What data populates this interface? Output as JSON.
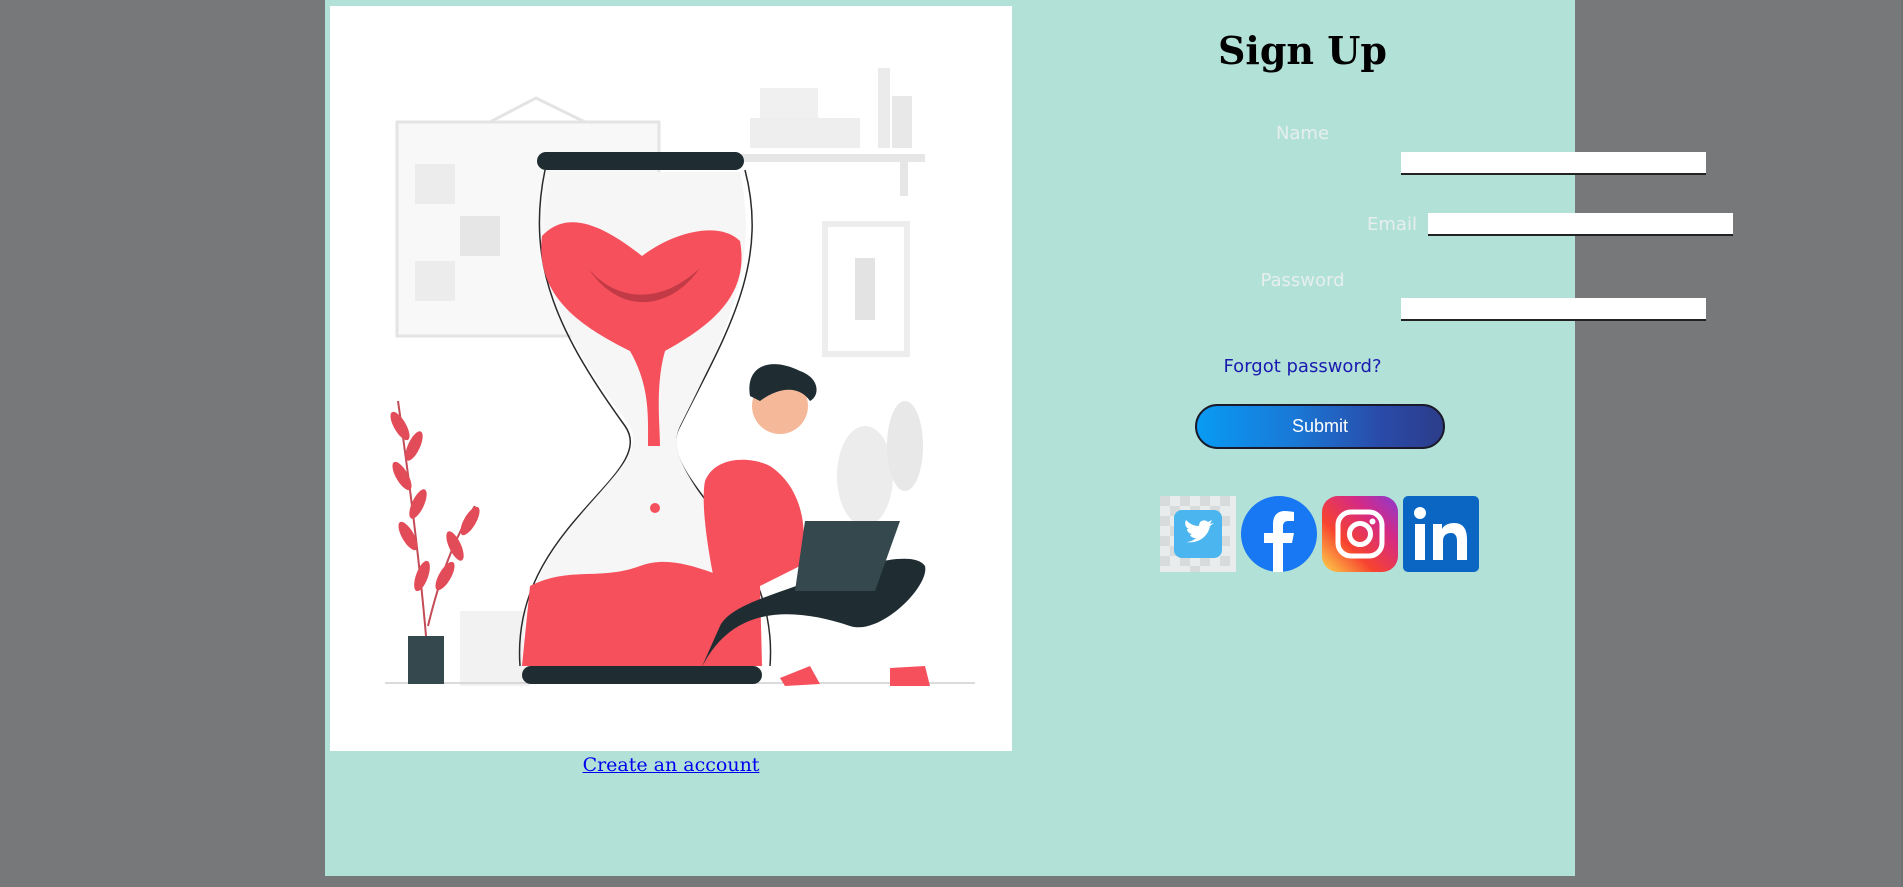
{
  "form": {
    "title": "Sign Up",
    "name_label": "Name",
    "email_label": "Email",
    "password_label": "Password",
    "name_value": "",
    "email_value": "",
    "password_value": "",
    "forgot_label": "Forgot password?",
    "submit_label": "Submit"
  },
  "illustration": {
    "icon": "hourglass-person-laptop-illustration"
  },
  "create_account_label": "Create an account",
  "social": [
    {
      "name": "twitter-icon",
      "color": "#4bb5ef"
    },
    {
      "name": "facebook-icon",
      "color": "#1877f2"
    },
    {
      "name": "instagram-icon",
      "color": "#e1306c"
    },
    {
      "name": "linkedin-icon",
      "color": "#0a66c2"
    }
  ],
  "colors": {
    "page_bg": "#77787a",
    "card_bg": "#b2e1d7",
    "accent_red": "#f6505c",
    "dark": "#1f2d33"
  }
}
